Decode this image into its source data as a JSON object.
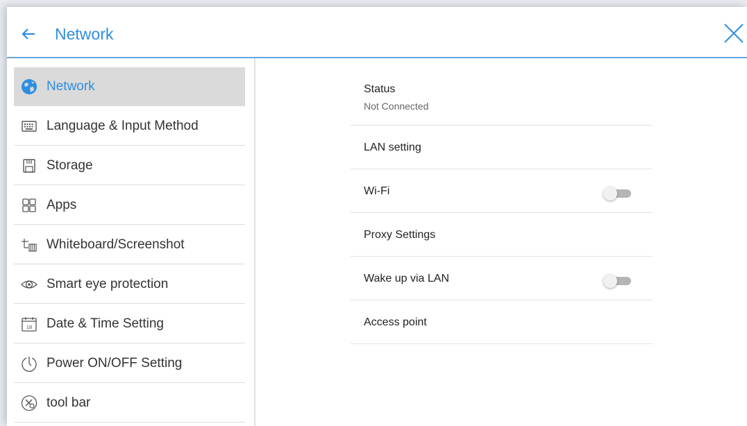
{
  "header": {
    "title": "Network",
    "back_icon": "arrow-left-icon",
    "close_icon": "close-icon",
    "accent_color": "#2d8ee0"
  },
  "sidebar": {
    "items": [
      {
        "label": "Network",
        "icon": "globe-icon",
        "active": true
      },
      {
        "label": "Language & Input Method",
        "icon": "keyboard-icon"
      },
      {
        "label": "Storage",
        "icon": "sd-card-icon"
      },
      {
        "label": "Apps",
        "icon": "apps-grid-icon"
      },
      {
        "label": "Whiteboard/Screenshot",
        "icon": "whiteboard-icon"
      },
      {
        "label": "Smart eye protection",
        "icon": "eye-icon"
      },
      {
        "label": "Date & Time Setting",
        "icon": "calendar-icon",
        "icon_text": "18"
      },
      {
        "label": "Power ON/OFF Setting",
        "icon": "power-timer-icon"
      },
      {
        "label": "tool bar",
        "icon": "toolbar-icon"
      }
    ]
  },
  "settings": {
    "status": {
      "label": "Status",
      "value": "Not Connected"
    },
    "lan_setting": {
      "label": "LAN setting"
    },
    "wifi": {
      "label": "Wi-Fi",
      "enabled": false
    },
    "proxy": {
      "label": "Proxy Settings"
    },
    "wake_lan": {
      "label": "Wake up via LAN",
      "enabled": false
    },
    "access_point": {
      "label": "Access point"
    }
  }
}
